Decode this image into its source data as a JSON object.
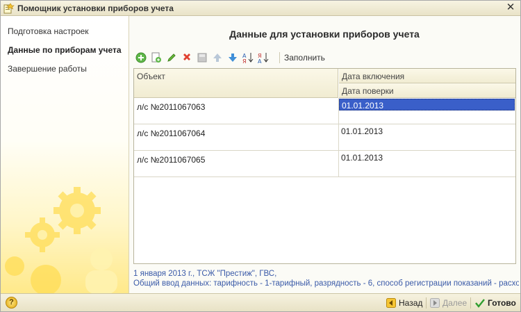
{
  "window": {
    "title": "Помощник установки приборов учета",
    "close_glyph": "✕"
  },
  "sidebar": {
    "steps": [
      {
        "label": "Подготовка настроек",
        "active": false
      },
      {
        "label": "Данные по приборам учета",
        "active": true
      },
      {
        "label": "Завершение работы",
        "active": false
      }
    ]
  },
  "main": {
    "heading": "Данные для установки приборов учета",
    "toolbar": {
      "icons": [
        "add-icon",
        "copy-icon",
        "edit-icon",
        "delete-icon",
        "save-icon",
        "move-up-icon",
        "move-down-icon",
        "sort-asc-icon",
        "sort-desc-icon"
      ],
      "fill_label": "Заполнить"
    },
    "table": {
      "columns": {
        "object": "Объект",
        "enable_date": "Дата включения",
        "check_date": "Дата поверки"
      },
      "rows": [
        {
          "object": "л/с №2011067063",
          "enable_date": "01.01.2013",
          "check_date": "",
          "selected": true
        },
        {
          "object": "л/с №2011067064",
          "enable_date": "01.01.2013",
          "check_date": "",
          "selected": false
        },
        {
          "object": "л/с №2011067065",
          "enable_date": "01.01.2013",
          "check_date": "",
          "selected": false
        }
      ]
    },
    "info": {
      "line1": "1 января 2013 г., ТСЖ \"Престиж\", ГВС,",
      "line2": "Общий ввод данных: тарифность - 1-тарифный, разрядность - 6, способ регистрации показаний - расход за"
    }
  },
  "footer": {
    "help_glyph": "?",
    "back_label": "Назад",
    "next_label": "Далее",
    "done_label": "Готово"
  },
  "colors": {
    "accent_selection": "#3a5fc9",
    "info_text": "#3a5aa8",
    "sidebar_yellow": "#ffe98a"
  }
}
